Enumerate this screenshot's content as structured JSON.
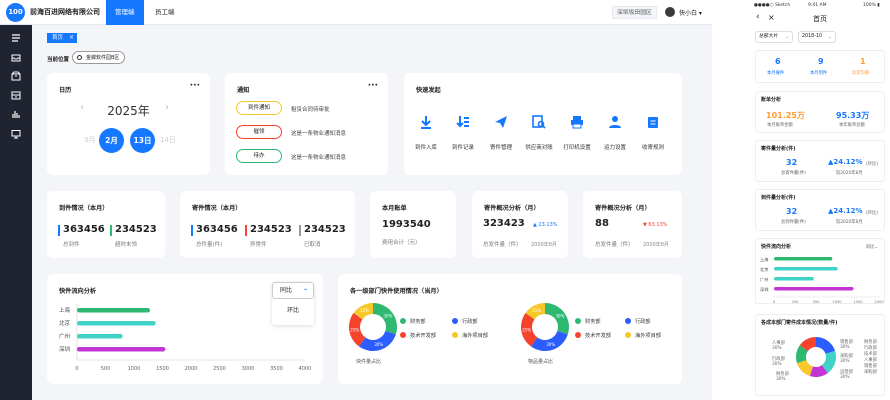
{
  "colors": {
    "primary": "#1677ff",
    "sidebar": "#1f2430",
    "green": "#2eb872",
    "purple": "#c335d4",
    "teal": "#3fd2c7",
    "orange": "#ff9a2e",
    "red": "#f5432c",
    "yellow": "#f7c82a",
    "blue": "#2b5dff"
  },
  "topbar": {
    "logo_text": "100",
    "brand": "前海百进网络有限公司",
    "tabs": [
      "管理端",
      "员工端"
    ],
    "district": "深圳坂田园区",
    "user": "快小白 ▾"
  },
  "icons": [
    "menu-icon",
    "inbox-icon",
    "box-icon",
    "archive-icon",
    "chart-icon",
    "monitor-icon"
  ],
  "breadcrumb": {
    "tag": "首页",
    "close": "×"
  },
  "location": {
    "label": "当前位置",
    "value": "金蝶软件园B区"
  },
  "calendar": {
    "title": "日历",
    "more": "···",
    "year": "2025年",
    "prev": "‹",
    "next": "›",
    "month_prev": "3月",
    "month": "2月",
    "day": "13日",
    "day_next": "14日"
  },
  "notice": {
    "title": "通知",
    "more": "···",
    "items": [
      {
        "tag": "到件通知",
        "text": "租赁合同待审批",
        "color": "#f7c82a"
      },
      {
        "tag": "催领",
        "text": "这是一条物业通知消息",
        "color": "#f5432c"
      },
      {
        "tag": "待办",
        "text": "这是一条物业通知消息",
        "color": "#2eb872"
      }
    ]
  },
  "quick": {
    "title": "快速发起",
    "items": [
      "到件入库",
      "到件记录",
      "寄件管理",
      "供应商对账",
      "打印机设置",
      "运力设置",
      "收寄规则"
    ]
  },
  "arrival": {
    "title": "到件情况（本月）",
    "items": [
      {
        "value": "363456",
        "label": "总到件",
        "color": "#1677ff"
      },
      {
        "value": "234523",
        "label": "超时未领",
        "color": "#2eb872"
      }
    ]
  },
  "send": {
    "title": "寄件情况（本月）",
    "items": [
      {
        "value": "363456",
        "label": "总件量(件)",
        "color": "#1677ff"
      },
      {
        "value": "234523",
        "label": "异常件",
        "color": "#f5432c"
      },
      {
        "value": "234523",
        "label": "已取消",
        "color": "#999999"
      }
    ]
  },
  "bill": {
    "title": "本月账单",
    "value": "1993540",
    "label": "费用合计（元）"
  },
  "send_analysis1": {
    "title": "寄件概况分析（月）",
    "value": "323423",
    "trend": "▲ 23.13%",
    "label": "总发件量（件）",
    "year": "2020年8月",
    "trend_color": "#1677ff"
  },
  "send_analysis2": {
    "title": "寄件概况分析（月）",
    "value": "88",
    "trend": "▼ 63.13%",
    "label": "总发件量（件）",
    "year": "2020年8月",
    "trend_color": "#f5432c"
  },
  "flow": {
    "title": "快件流向分析",
    "popup_btn": "同比",
    "popup_caret": "⌃",
    "popup_option": "环比"
  },
  "flow_chart": {
    "type": "bar",
    "categories": [
      "上海",
      "北京",
      "广州",
      "深圳"
    ],
    "values": [
      1280,
      1380,
      800,
      1550
    ],
    "colors": [
      "#2eb872",
      "#3fd2c7",
      "#3fd2c7",
      "#c335d4"
    ],
    "xlim": [
      0,
      4000
    ],
    "ticks": [
      "0",
      "500",
      "1000",
      "1500",
      "2000",
      "2500",
      "3000",
      "3500",
      "4000"
    ]
  },
  "dept": {
    "title": "各一级部门快件使用情况（当月）",
    "legend": [
      {
        "name": "财务部",
        "color": "#2eb872"
      },
      {
        "name": "行政部",
        "color": "#2b5dff"
      },
      {
        "name": "技术开发部",
        "color": "#f5432c"
      },
      {
        "name": "海外项目部",
        "color": "#f7c82a"
      }
    ],
    "cap1": "快件量占比",
    "cap2": "物品量占比"
  },
  "chart_data": [
    {
      "type": "bar",
      "title": "快件流向分析",
      "categories": [
        "上海",
        "北京",
        "广州",
        "深圳"
      ],
      "values": [
        1280,
        1380,
        800,
        1550
      ],
      "xlim": [
        0,
        4000
      ]
    },
    {
      "type": "pie",
      "title": "快件量占比",
      "categories": [
        "财务部",
        "行政部",
        "技术开发部",
        "海外项目部"
      ],
      "values": [
        30,
        30,
        25,
        15
      ],
      "labels": [
        "30%",
        "30%",
        "25%",
        "15%"
      ]
    },
    {
      "type": "pie",
      "title": "物品量占比",
      "categories": [
        "财务部",
        "行政部",
        "技术开发部",
        "海外项目部"
      ],
      "values": [
        30,
        30,
        25,
        15
      ],
      "labels": [
        "30%",
        "30%",
        "25%",
        "15%"
      ]
    },
    {
      "type": "bar",
      "title": "快件流向分析",
      "categories": [
        "上海",
        "北京",
        "广州",
        "深圳"
      ],
      "values": [
        1100,
        1200,
        750,
        1500
      ],
      "xlim": [
        0,
        2000
      ]
    }
  ],
  "mobile": {
    "status_left": "●●●●○ Sketch",
    "status_time": "9:41 AM",
    "status_right": "100% ▮",
    "back": "‹",
    "close": "×",
    "title": "首页",
    "sel1": "总部大片",
    "sel2": "2018-10",
    "sel_caret": "⌄",
    "kpis": [
      {
        "value": "6",
        "label": "本月催件",
        "color": "#1677ff"
      },
      {
        "value": "9",
        "label": "本月到件",
        "color": "#1677ff"
      },
      {
        "value": "1",
        "label": "异常包裹",
        "color": "#ff9a2e"
      }
    ],
    "bill": {
      "title": "账单分析",
      "items": [
        {
          "value": "101.25万",
          "label": "本月账单金额",
          "color": "#ff9a2e"
        },
        {
          "value": "95.33万",
          "label": "本年账单总额",
          "color": "#1677ff"
        }
      ]
    },
    "send": {
      "title": "寄件量分析(件)",
      "value": "32",
      "label": "总寄件量(件)",
      "trend": "▲24.12%",
      "trend_sub": "较2020年8月",
      "trend_label": "(环比)"
    },
    "arrive": {
      "title": "到件量分析(件)",
      "value": "32",
      "label": "总到件量(件)",
      "trend": "▲24.12%",
      "trend_sub": "较2020年8月",
      "trend_label": "(环比)"
    },
    "flow": {
      "title": "快件流向分析",
      "btn": "同比⌄",
      "categories": [
        "上海",
        "北京",
        "广州",
        "深圳"
      ],
      "ticks": [
        "0",
        "200",
        "500",
        "1000",
        "1500",
        "2000"
      ]
    },
    "dept": {
      "title": "各成本部门寄件成本情况(数量/件)",
      "labels": [
        "人事部",
        "行政部",
        "财务部",
        "销售部",
        "采购部",
        "运营部"
      ],
      "pct": [
        "30%",
        "30%",
        "30%",
        "30%",
        "30%",
        "30%"
      ],
      "legend": [
        "财务部",
        "行政部",
        "技术部",
        "人事部",
        "销售部",
        "采购部"
      ]
    }
  }
}
